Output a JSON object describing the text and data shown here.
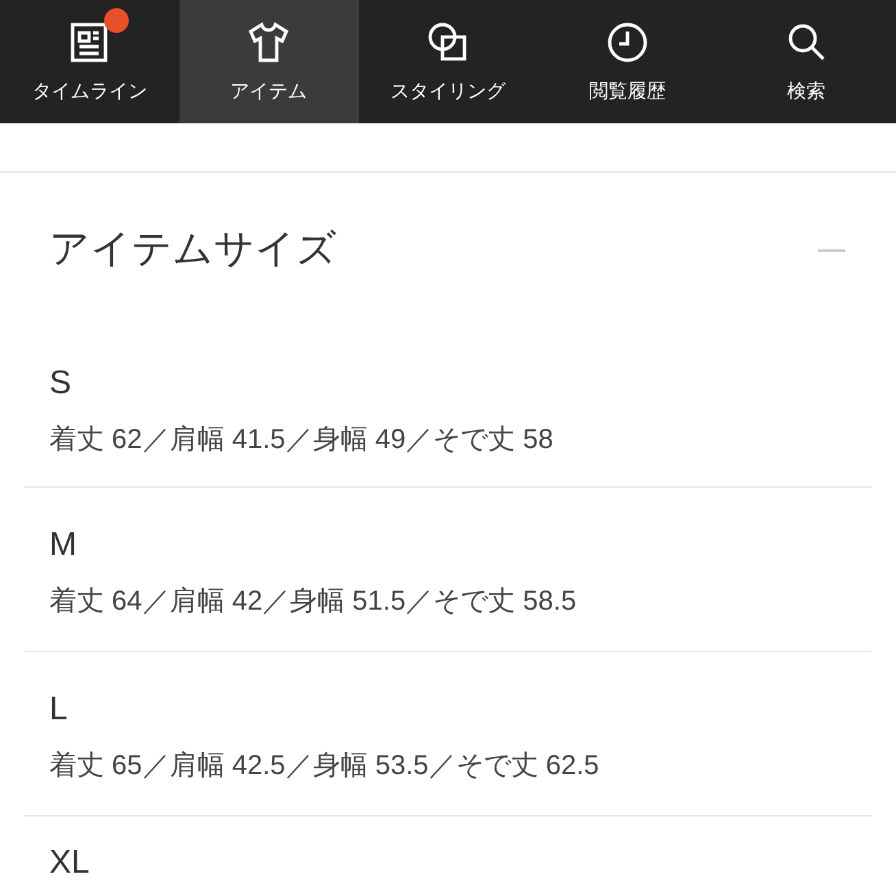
{
  "tabs": [
    {
      "label": "タイムライン",
      "kind": "timeline",
      "selected": false,
      "badge": true
    },
    {
      "label": "アイテム",
      "kind": "item",
      "selected": true,
      "badge": false
    },
    {
      "label": "スタイリング",
      "kind": "styling",
      "selected": false,
      "badge": false
    },
    {
      "label": "閲覧履歴",
      "kind": "history",
      "selected": false,
      "badge": false
    },
    {
      "label": "検索",
      "kind": "search",
      "selected": false,
      "badge": false
    }
  ],
  "section": {
    "title": "アイテムサイズ",
    "expanded": true
  },
  "sizes": [
    {
      "size": "S",
      "detail": "着丈 62／肩幅 41.5／身幅 49／そで丈 58"
    },
    {
      "size": "M",
      "detail": "着丈 64／肩幅 42／身幅 51.5／そで丈 58.5"
    },
    {
      "size": "L",
      "detail": "着丈 65／肩幅 42.5／身幅 53.5／そで丈 62.5"
    },
    {
      "size": "XL"
    }
  ]
}
